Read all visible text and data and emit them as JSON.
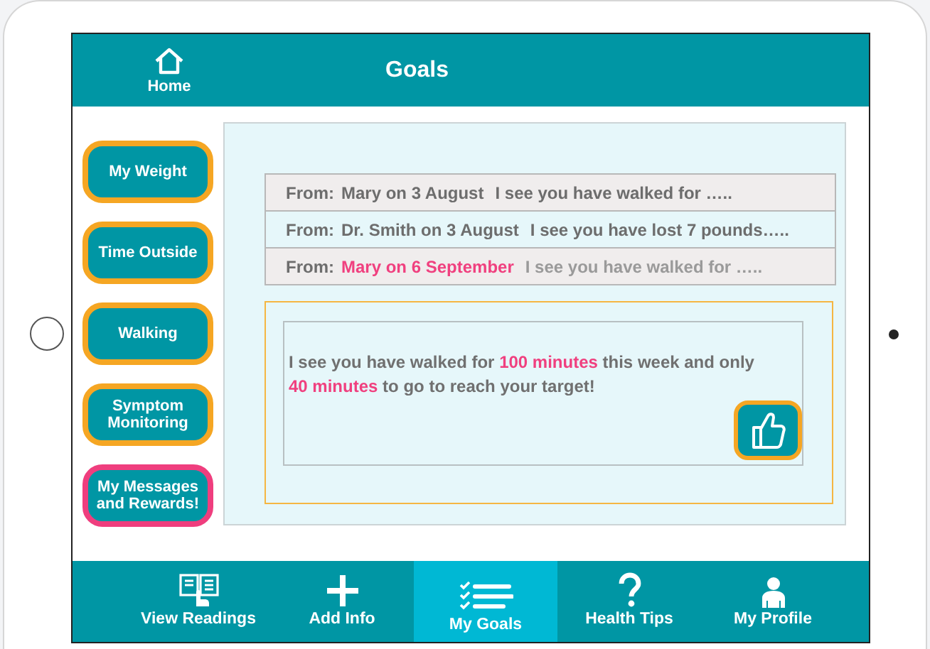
{
  "header": {
    "home_label": "Home",
    "title": "Goals"
  },
  "sidebar": [
    {
      "label": "My Weight",
      "selected": false
    },
    {
      "label": "Time Outside",
      "selected": false
    },
    {
      "label": "Walking",
      "selected": false
    },
    {
      "label": "Symptom Monitoring",
      "selected": false
    },
    {
      "label": "My Messages and Rewards!",
      "selected": true
    }
  ],
  "messages": [
    {
      "prefix": "From:",
      "sender": "Mary on 3 August",
      "preview": "I see you have walked for …..",
      "unread": false,
      "color": "#f0eded"
    },
    {
      "prefix": "From:",
      "sender": "Dr. Smith on 3 August",
      "preview": "I see you have lost 7 pounds…..",
      "unread": false,
      "color": "#e6f7fa"
    },
    {
      "prefix": "From:",
      "sender": "Mary on 6 September",
      "preview": "I see you have walked for …..",
      "unread": true,
      "color": "#f0eded"
    }
  ],
  "message_body": [
    {
      "text": "I see you have walked for ",
      "highlight": false
    },
    {
      "text": "100 minutes",
      "highlight": true
    },
    {
      "text": " this week and only ",
      "highlight": false
    },
    {
      "text": "40 minutes",
      "highlight": true
    },
    {
      "text": " to go to reach your target!",
      "highlight": false
    }
  ],
  "nav": [
    {
      "label": "View Readings",
      "kind": "readings",
      "selected": false
    },
    {
      "label": "Add Info",
      "kind": "add",
      "selected": false
    },
    {
      "label": "My Goals",
      "kind": "goals",
      "selected": true
    },
    {
      "label": "Health Tips",
      "kind": "tips",
      "selected": false
    },
    {
      "label": "My Profile",
      "kind": "profile",
      "selected": false
    }
  ]
}
